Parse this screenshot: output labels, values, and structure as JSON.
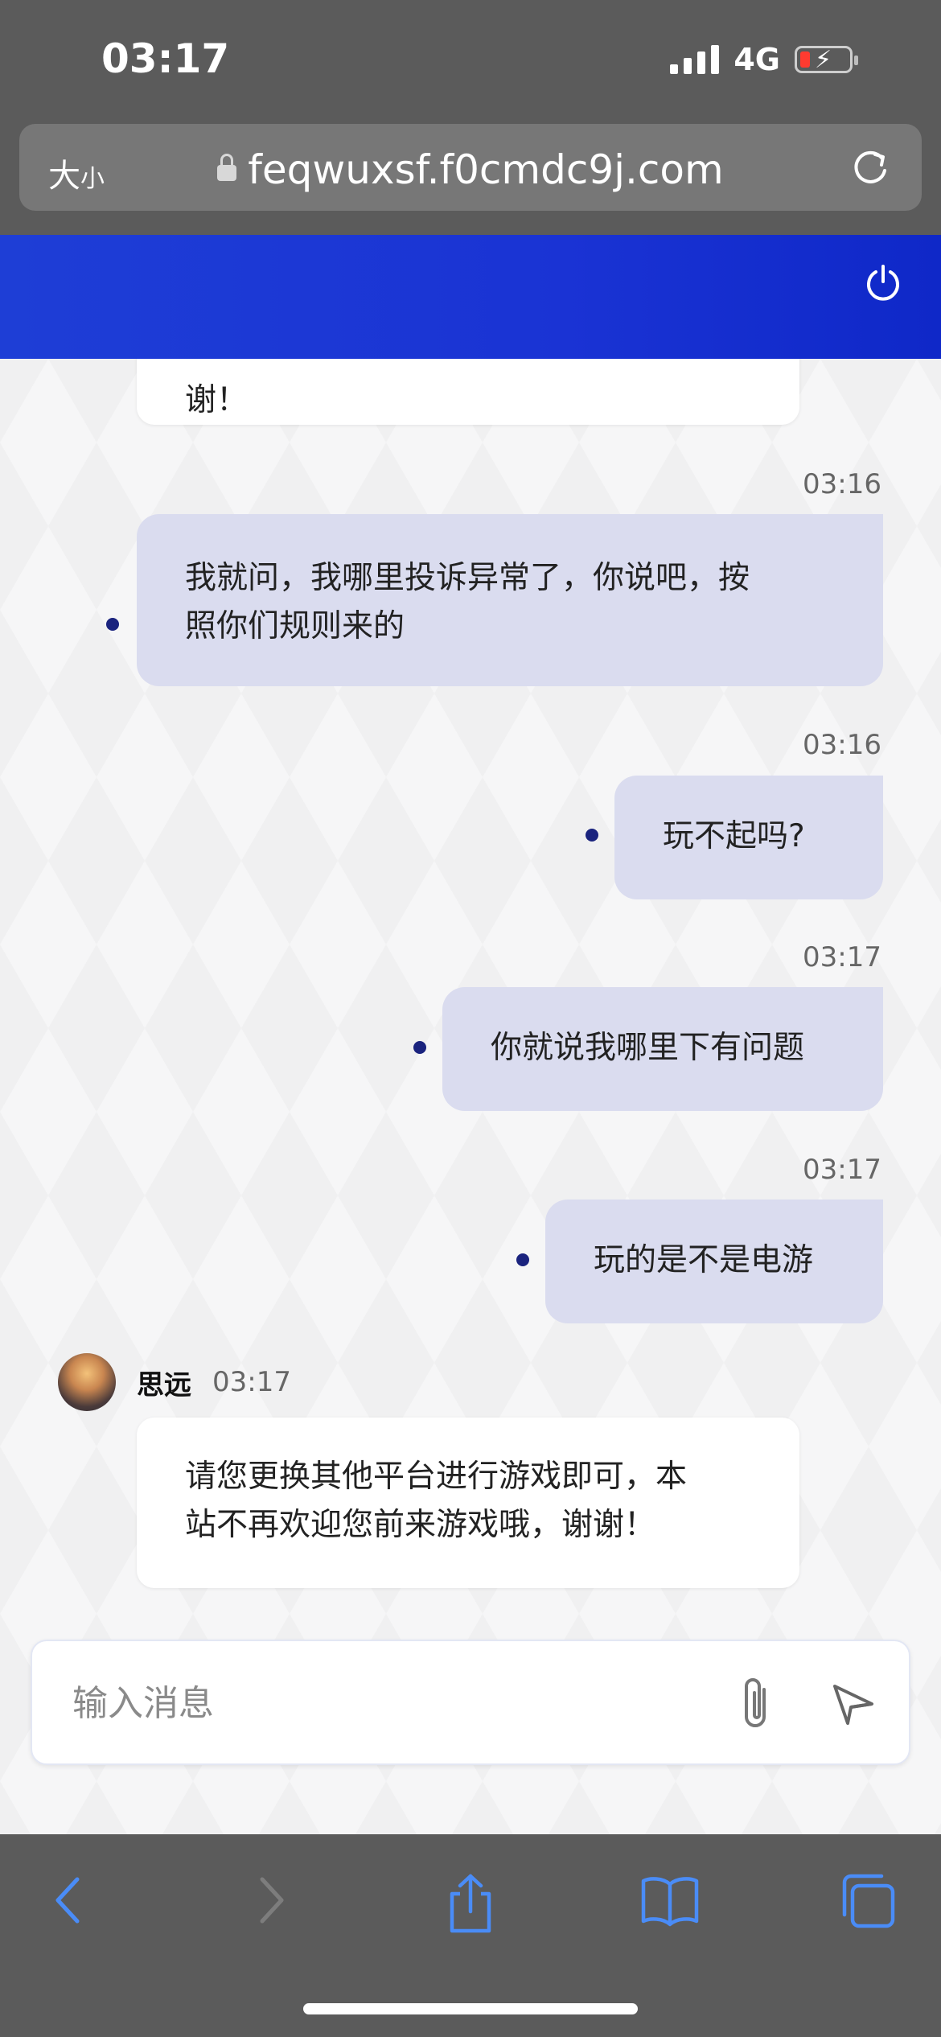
{
  "status_bar": {
    "time": "03:17",
    "network": "4G"
  },
  "browser": {
    "text_size_label": "大",
    "text_size_small": "小",
    "url": "feqwuxsf.f0cmdc9j.com"
  },
  "chat": {
    "prev_agent_tail": "谢！",
    "messages": [
      {
        "time": "03:16",
        "lines": [
          "我就问，我哪里投诉异常了，你说吧，按",
          "照你们规则来的"
        ]
      },
      {
        "time": "03:16",
        "lines": [
          "玩不起吗?"
        ]
      },
      {
        "time": "03:17",
        "lines": [
          "你就说我哪里下有问题"
        ]
      },
      {
        "time": "03:17",
        "lines": [
          "玩的是不是电游"
        ]
      }
    ],
    "agent": {
      "name": "思远",
      "time": "03:17",
      "lines": [
        "请您更换其他平台进行游戏即可，本",
        "站不再欢迎您前来游戏哦，谢谢！"
      ]
    }
  },
  "input": {
    "placeholder": "输入消息",
    "value": ""
  },
  "colors": {
    "header_blue": "#1a33d4",
    "bubble": "#dadcef",
    "dot": "#1a237e",
    "chrome": "#5b5b5b",
    "toolbar_icon": "#4a8cf7"
  }
}
